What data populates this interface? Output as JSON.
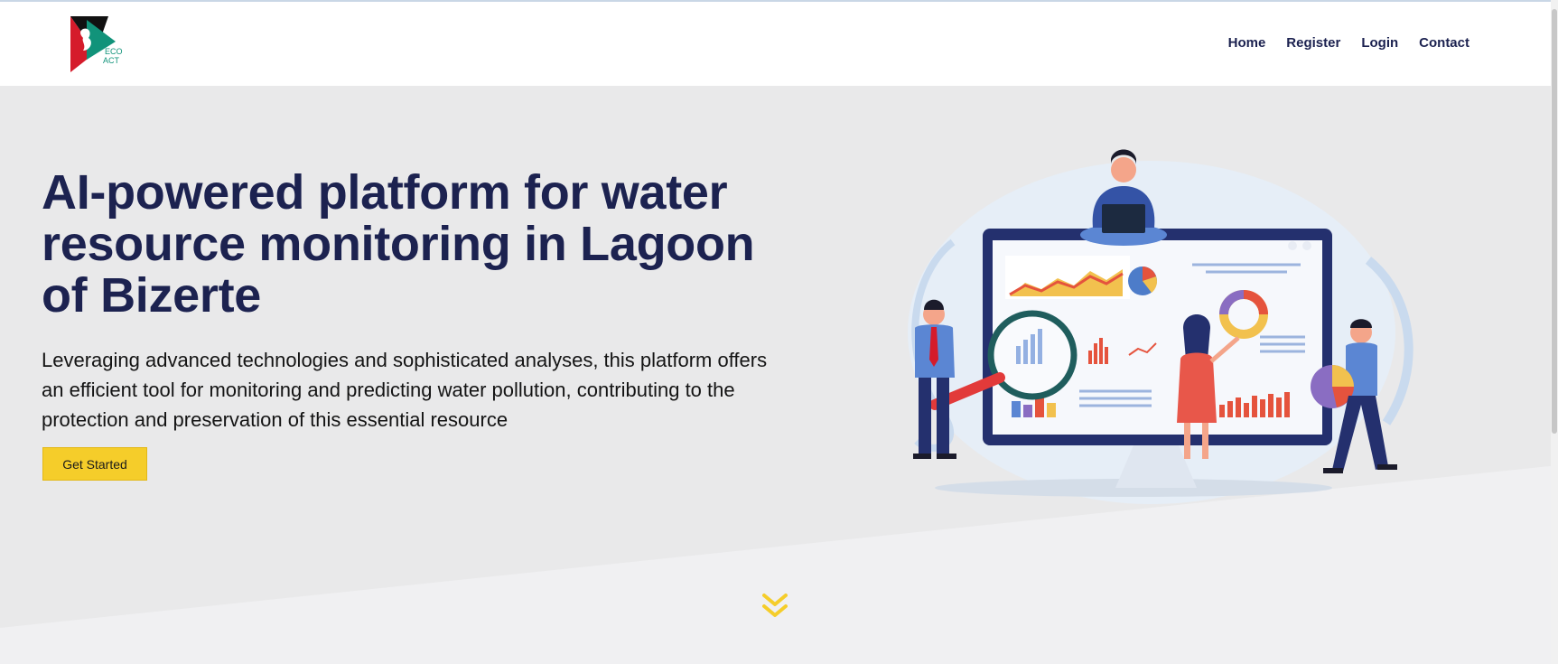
{
  "header": {
    "logo_text_line1": "ECO",
    "logo_text_line2": "ACT",
    "nav": [
      {
        "label": "Home"
      },
      {
        "label": "Register"
      },
      {
        "label": "Login"
      },
      {
        "label": "Contact"
      }
    ]
  },
  "hero": {
    "title": "AI-powered platform for water resource monitoring in Lagoon of Bizerte",
    "description": "Leveraging advanced technologies and sophisticated analyses, this platform offers an efficient tool for monitoring and predicting water pollution, contributing to the protection and preservation of this essential resource",
    "cta_label": "Get Started"
  },
  "colors": {
    "navy": "#1c2250",
    "accent_yellow": "#f5cd2a",
    "hero_bg": "#e9e9ea",
    "logo_red": "#d51b2b",
    "logo_green": "#11937a"
  }
}
